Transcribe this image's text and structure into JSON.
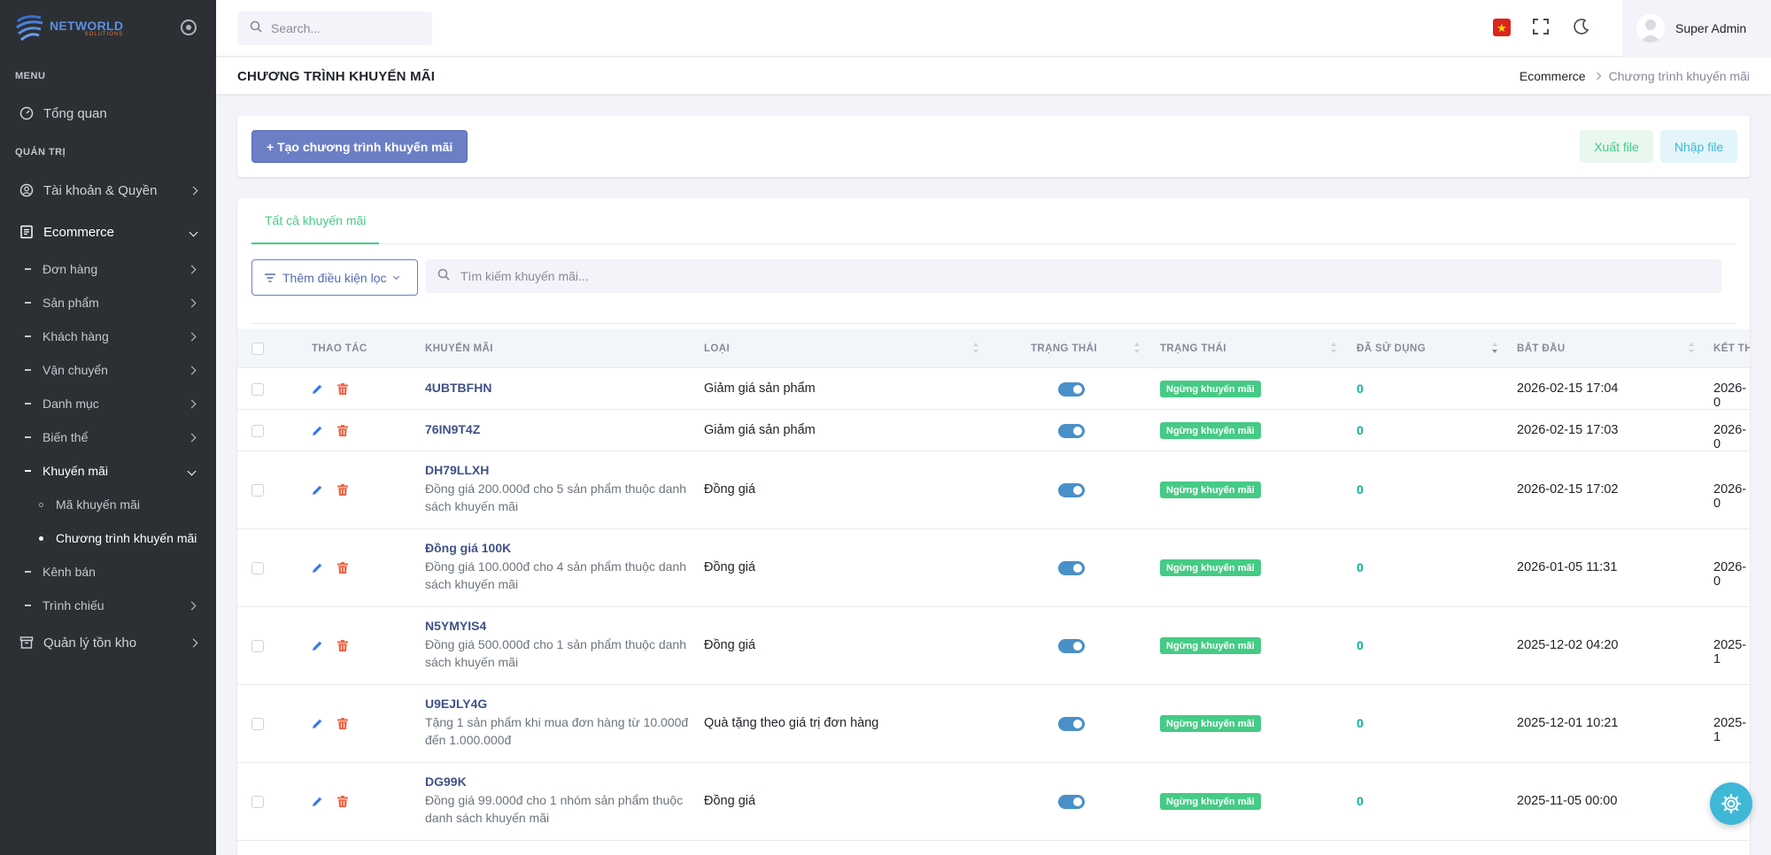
{
  "logo": {
    "line1": "NETWORLD",
    "line2": "SOLUTIONS"
  },
  "sidebar": {
    "menu_title": "MENU",
    "admin_title": "QUẢN TRỊ",
    "overview": "Tổng quan",
    "accounts": "Tài khoản & Quyền",
    "ecommerce": "Ecommerce",
    "sub": {
      "orders": "Đơn hàng",
      "products": "Sản phẩm",
      "customers": "Khách hàng",
      "shipping": "Vận chuyển",
      "categories": "Danh mục",
      "variants": "Biến thể",
      "promotions": "Khuyến mãi",
      "promo_codes": "Mã khuyến mãi",
      "promo_programs": "Chương trình khuyến mãi",
      "channels": "Kênh bán",
      "slideshow": "Trình chiếu"
    },
    "inventory": "Quản lý tồn kho"
  },
  "topbar": {
    "search_placeholder": "Search...",
    "user_name": "Super Admin"
  },
  "page": {
    "title": "CHƯƠNG TRÌNH KHUYẾN MÃI",
    "breadcrumb": [
      "Ecommerce",
      "Chương trình khuyến mãi"
    ]
  },
  "toolbar": {
    "create_label": "+ Tạo chương trình khuyến mãi",
    "export_label": "Xuất file",
    "import_label": "Nhập file"
  },
  "tabs": {
    "all": "Tất cả khuyến mãi"
  },
  "filter": {
    "add_condition": "Thêm điều kiện lọc",
    "search_placeholder": "Tìm kiếm khuyến mãi..."
  },
  "table": {
    "headers": {
      "actions": "THAO TÁC",
      "promotion": "KHUYẾN MÃI",
      "type": "LOẠI",
      "status_toggle": "TRẠNG THÁI",
      "status": "TRẠNG THÁI",
      "used": "ĐÃ SỬ DỤNG",
      "start": "BẮT ĐẦU",
      "end": "KẾT TH"
    },
    "rows": [
      {
        "code": "4UBTBFHN",
        "desc": "",
        "type": "Giảm giá sản phẩm",
        "status": "Ngừng khuyến mãi",
        "used": "0",
        "start": "2026-02-15 17:04",
        "end": "2026-0"
      },
      {
        "code": "76IN9T4Z",
        "desc": "",
        "type": "Giảm giá sản phẩm",
        "status": "Ngừng khuyến mãi",
        "used": "0",
        "start": "2026-02-15 17:03",
        "end": "2026-0"
      },
      {
        "code": "DH79LLXH",
        "desc": "Đồng giá 200.000đ cho 5 sản phẩm thuộc danh sách khuyến mãi",
        "type": "Đồng giá",
        "status": "Ngừng khuyến mãi",
        "used": "0",
        "start": "2026-02-15 17:02",
        "end": "2026-0"
      },
      {
        "code": "Đồng giá 100K",
        "desc": "Đồng giá 100.000đ cho 4 sản phẩm thuộc danh sách khuyến mãi",
        "type": "Đồng giá",
        "status": "Ngừng khuyến mãi",
        "used": "0",
        "start": "2026-01-05 11:31",
        "end": "2026-0"
      },
      {
        "code": "N5YMYIS4",
        "desc": "Đồng giá 500.000đ cho 1 sản phẩm thuộc danh sách khuyến mãi",
        "type": "Đồng giá",
        "status": "Ngừng khuyến mãi",
        "used": "0",
        "start": "2025-12-02 04:20",
        "end": "2025-1"
      },
      {
        "code": "U9EJLY4G",
        "desc": "Tặng 1 sản phẩm khi mua đơn hàng từ 10.000đ đến 1.000.000đ",
        "type": "Quà tặng theo giá trị đơn hàng",
        "status": "Ngừng khuyến mãi",
        "used": "0",
        "start": "2025-12-01 10:21",
        "end": "2025-1"
      },
      {
        "code": "DG99K",
        "desc": "Đồng giá 99.000đ cho 1 nhóm sản phẩm thuộc danh sách khuyến mãi",
        "type": "Đồng giá",
        "status": "Ngừng khuyến mãi",
        "used": "0",
        "start": "2025-11-05 00:00",
        "end": ""
      }
    ]
  },
  "colors": {
    "primary": "#6c7fc6",
    "success": "#45cb85",
    "info": "#3fb8d8",
    "sidebar": "#2c3035"
  }
}
